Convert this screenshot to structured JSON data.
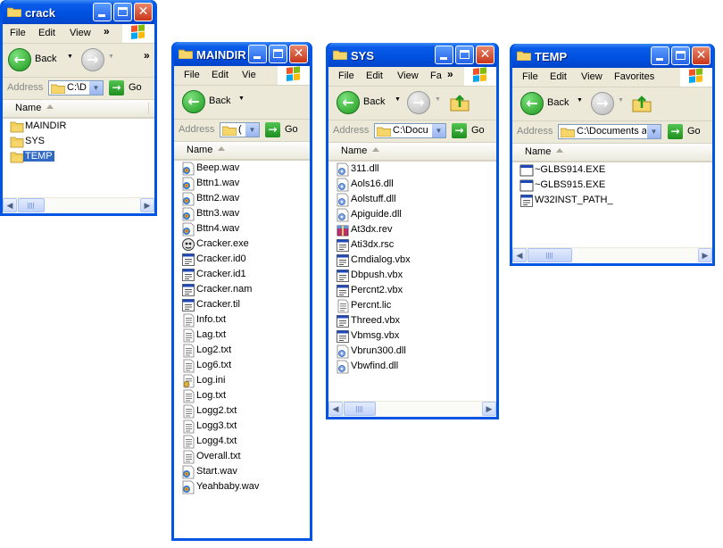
{
  "windows": [
    {
      "title": "crack",
      "menu": [
        "File",
        "Edit",
        "View"
      ],
      "menu_more": "»",
      "back_label": "Back",
      "address_label": "Address",
      "address_value": "C:\\D",
      "go_label": "Go",
      "column_header": "Name",
      "items": [
        {
          "name": "MAINDIR",
          "icon": "folder-icon",
          "selected": false
        },
        {
          "name": "SYS",
          "icon": "folder-icon",
          "selected": false
        },
        {
          "name": "TEMP",
          "icon": "folder-icon",
          "selected": true
        }
      ]
    },
    {
      "title": "MAINDIR",
      "menu": [
        "File",
        "Edit",
        "Vie"
      ],
      "menu_more": "",
      "back_label": "Back",
      "address_label": "Address",
      "address_value": "(",
      "go_label": "Go",
      "column_header": "Name",
      "items": [
        {
          "name": "Beep.wav",
          "icon": "audio-file-icon"
        },
        {
          "name": "Bttn1.wav",
          "icon": "audio-file-icon"
        },
        {
          "name": "Bttn2.wav",
          "icon": "audio-file-icon"
        },
        {
          "name": "Bttn3.wav",
          "icon": "audio-file-icon"
        },
        {
          "name": "Bttn4.wav",
          "icon": "audio-file-icon"
        },
        {
          "name": "Cracker.exe",
          "icon": "application-icon"
        },
        {
          "name": "Cracker.id0",
          "icon": "generic-file-icon"
        },
        {
          "name": "Cracker.id1",
          "icon": "generic-file-icon"
        },
        {
          "name": "Cracker.nam",
          "icon": "generic-file-icon"
        },
        {
          "name": "Cracker.til",
          "icon": "generic-file-icon"
        },
        {
          "name": "Info.txt",
          "icon": "text-file-icon"
        },
        {
          "name": "Lag.txt",
          "icon": "text-file-icon"
        },
        {
          "name": "Log2.txt",
          "icon": "text-file-icon"
        },
        {
          "name": "Log6.txt",
          "icon": "text-file-icon"
        },
        {
          "name": "Log.ini",
          "icon": "ini-file-icon"
        },
        {
          "name": "Log.txt",
          "icon": "text-file-icon"
        },
        {
          "name": "Logg2.txt",
          "icon": "text-file-icon"
        },
        {
          "name": "Logg3.txt",
          "icon": "text-file-icon"
        },
        {
          "name": "Logg4.txt",
          "icon": "text-file-icon"
        },
        {
          "name": "Overall.txt",
          "icon": "text-file-icon"
        },
        {
          "name": "Start.wav",
          "icon": "audio-file-icon"
        },
        {
          "name": "Yeahbaby.wav",
          "icon": "audio-file-icon"
        }
      ]
    },
    {
      "title": "SYS",
      "menu": [
        "File",
        "Edit",
        "View",
        "Fa"
      ],
      "menu_more": "»",
      "back_label": "Back",
      "address_label": "Address",
      "address_value": "C:\\Docu",
      "go_label": "Go",
      "column_header": "Name",
      "items": [
        {
          "name": "311.dll",
          "icon": "dll-file-icon"
        },
        {
          "name": "Aols16.dll",
          "icon": "dll-file-icon"
        },
        {
          "name": "Aolstuff.dll",
          "icon": "dll-file-icon"
        },
        {
          "name": "Apiguide.dll",
          "icon": "dll-file-icon"
        },
        {
          "name": "At3dx.rev",
          "icon": "archive-file-icon"
        },
        {
          "name": "Ati3dx.rsc",
          "icon": "generic-file-icon"
        },
        {
          "name": "Cmdialog.vbx",
          "icon": "generic-file-icon"
        },
        {
          "name": "Dbpush.vbx",
          "icon": "generic-file-icon"
        },
        {
          "name": "Percnt2.vbx",
          "icon": "generic-file-icon"
        },
        {
          "name": "Percnt.lic",
          "icon": "text-file-icon"
        },
        {
          "name": "Threed.vbx",
          "icon": "generic-file-icon"
        },
        {
          "name": "Vbmsg.vbx",
          "icon": "generic-file-icon"
        },
        {
          "name": "Vbrun300.dll",
          "icon": "dll-file-icon"
        },
        {
          "name": "Vbwfind.dll",
          "icon": "dll-file-icon"
        }
      ]
    },
    {
      "title": "TEMP",
      "menu": [
        "File",
        "Edit",
        "View",
        "Favorites"
      ],
      "menu_more": "",
      "back_label": "Back",
      "address_label": "Address",
      "address_value": "C:\\Documents a",
      "go_label": "Go",
      "column_header": "Name",
      "items": [
        {
          "name": "~GLBS914.EXE",
          "icon": "exe-window-icon"
        },
        {
          "name": "~GLBS915.EXE",
          "icon": "exe-window-icon"
        },
        {
          "name": "W32INST_PATH_",
          "icon": "generic-file-icon"
        }
      ]
    }
  ]
}
